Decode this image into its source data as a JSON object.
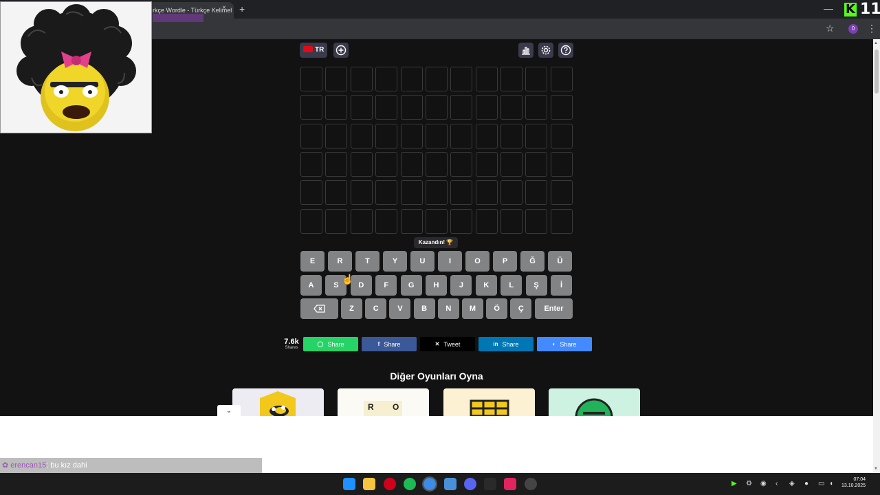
{
  "browser": {
    "tab_title": "rkçe Wordle - Türkçe Kelimel",
    "tab_close_glyph": "×",
    "new_tab_glyph": "+",
    "minimize_glyph": "—",
    "star_glyph": "☆",
    "profile_initial": "0",
    "kebab_glyph": "⋮",
    "kick_logo": "K",
    "overlay_number": "11"
  },
  "toolbar": {
    "language": "TR",
    "icons": [
      "plus-circle-icon",
      "stats-icon",
      "gear-icon",
      "help-icon"
    ]
  },
  "grid": {
    "rows": 6,
    "cols": 11
  },
  "toast": "Kazandın! 🏆",
  "keyboard": {
    "row1": [
      "E",
      "R",
      "T",
      "Y",
      "U",
      "I",
      "O",
      "P",
      "Ğ",
      "Ü"
    ],
    "row2": [
      "A",
      "S",
      "D",
      "F",
      "G",
      "H",
      "J",
      "K",
      "L",
      "Ş",
      "İ"
    ],
    "row3": [
      "Z",
      "C",
      "V",
      "B",
      "N",
      "M",
      "Ö",
      "Ç"
    ],
    "enter": "Enter",
    "backspace_icon": "backspace-icon"
  },
  "share": {
    "count": "7.6k",
    "count_label": "Shares",
    "buttons": [
      {
        "network": "whatsapp",
        "label": "Share",
        "color": "#25d366",
        "icon": "whatsapp-icon"
      },
      {
        "network": "facebook",
        "label": "Share",
        "color": "#3b5998",
        "icon": "facebook-icon"
      },
      {
        "network": "x",
        "label": "Tweet",
        "color": "#000000",
        "icon": "x-icon"
      },
      {
        "network": "linkedin",
        "label": "Share",
        "color": "#0077b5",
        "icon": "linkedin-icon"
      },
      {
        "network": "messenger",
        "label": "Share",
        "color": "#448aff",
        "icon": "messenger-icon"
      }
    ]
  },
  "other_games": {
    "title": "Diğer Oyunları Oyna",
    "card_letters": [
      "R",
      "O"
    ]
  },
  "chat": {
    "username": "erencan15",
    "message": ": bu kız dahi"
  },
  "taskbar": {
    "time": "07:04",
    "date": "13.10.2025"
  },
  "colors": {
    "background": "#121213",
    "key": "#818384",
    "tile_border": "#3a3a3c",
    "toolbar_button": "#3a3a4c"
  }
}
